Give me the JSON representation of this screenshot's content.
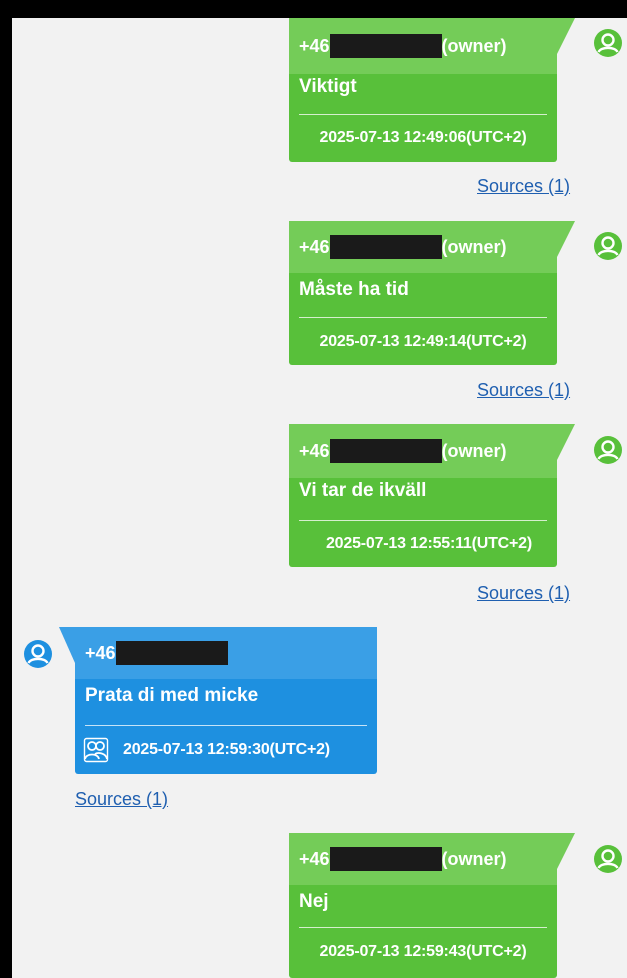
{
  "colors": {
    "outgoing_bubble": "#58c03a",
    "outgoing_header": "#74cc58",
    "incoming_bubble": "#1e90e0",
    "incoming_header": "#3a9fe6",
    "link": "#1f5fb0",
    "avatar_green": "#58c03a",
    "avatar_blue": "#1e90e0"
  },
  "messages": [
    {
      "sender_prefix": "+46",
      "owner_tag": "(owner)",
      "text": "Viktigt",
      "timestamp": "2025-07-13 12:49:06(UTC+2)",
      "sources": "Sources (1)"
    },
    {
      "sender_prefix": "+46",
      "owner_tag": "(owner)",
      "text": "Måste ha tid",
      "timestamp": "2025-07-13 12:49:14(UTC+2)",
      "sources": "Sources (1)"
    },
    {
      "sender_prefix": "+46",
      "owner_tag": "(owner)",
      "text": "Vi tar de ikväll",
      "timestamp": "2025-07-13 12:55:11(UTC+2)",
      "sources": "Sources (1)"
    },
    {
      "sender_prefix": "+46",
      "owner_tag": "",
      "text": "Prata di med micke",
      "timestamp": "2025-07-13 12:59:30(UTC+2)",
      "sources": "Sources (1)",
      "icon": "group-chat-icon"
    },
    {
      "sender_prefix": "+46",
      "owner_tag": "(owner)",
      "text": "Nej",
      "timestamp": "2025-07-13 12:59:43(UTC+2)",
      "sources": ""
    }
  ]
}
